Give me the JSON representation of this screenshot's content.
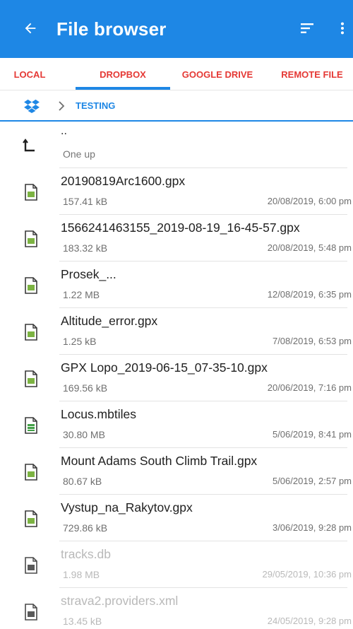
{
  "toolbar": {
    "title": "File browser",
    "back_icon": "arrow-back-icon",
    "sort_icon": "sort-icon",
    "more_icon": "more-vert-icon",
    "background": "#1e87e5"
  },
  "tabs": [
    {
      "label": "LOCAL",
      "selected": false
    },
    {
      "label": "DROPBOX",
      "selected": true
    },
    {
      "label": "GOOGLE DRIVE",
      "selected": false
    },
    {
      "label": "REMOTE FILE",
      "selected": false
    }
  ],
  "tab_color": "#e53935",
  "accent_color": "#1e87e5",
  "breadcrumb": {
    "root_icon": "dropbox-icon",
    "separator_icon": "chevron-right-icon",
    "current": "TESTING"
  },
  "files": {
    "up": {
      "name": "..",
      "subtitle": "One up",
      "icon": "level-up-icon"
    },
    "items": [
      {
        "name": "20190819Arc1600.gpx",
        "size": "157.41 kB",
        "date": "20/08/2019, 6:00 pm",
        "icon": "gpx-file-icon",
        "enabled": true
      },
      {
        "name": "1566241463155_2019-08-19_16-45-57.gpx",
        "size": "183.32 kB",
        "date": "20/08/2019, 5:48 pm",
        "icon": "gpx-file-icon",
        "enabled": true
      },
      {
        "name": "Prosek_...",
        "size": "1.22 MB",
        "date": "12/08/2019, 6:35 pm",
        "icon": "gpx-file-icon",
        "enabled": true
      },
      {
        "name": "Altitude_error.gpx",
        "size": "1.25 kB",
        "date": "7/08/2019, 6:53 pm",
        "icon": "gpx-file-icon",
        "enabled": true
      },
      {
        "name": "GPX Lopo_2019-06-15_07-35-10.gpx",
        "size": "169.56 kB",
        "date": "20/06/2019, 7:16 pm",
        "icon": "gpx-file-icon",
        "enabled": true
      },
      {
        "name": "Locus.mbtiles",
        "size": "30.80 MB",
        "date": "5/06/2019, 8:41 pm",
        "icon": "map-file-icon",
        "enabled": true
      },
      {
        "name": "Mount Adams South Climb Trail.gpx",
        "size": "80.67 kB",
        "date": "5/06/2019, 2:57 pm",
        "icon": "gpx-file-icon",
        "enabled": true
      },
      {
        "name": "Vystup_na_Rakytov.gpx",
        "size": "729.86 kB",
        "date": "3/06/2019, 9:28 pm",
        "icon": "gpx-file-icon",
        "enabled": true
      },
      {
        "name": "tracks.db",
        "size": "1.98 MB",
        "date": "29/05/2019, 10:36 pm",
        "icon": "db-file-icon",
        "enabled": false
      },
      {
        "name": "strava2.providers.xml",
        "size": "13.45 kB",
        "date": "24/05/2019, 9:28 pm",
        "icon": "xml-file-icon",
        "enabled": false
      }
    ]
  }
}
